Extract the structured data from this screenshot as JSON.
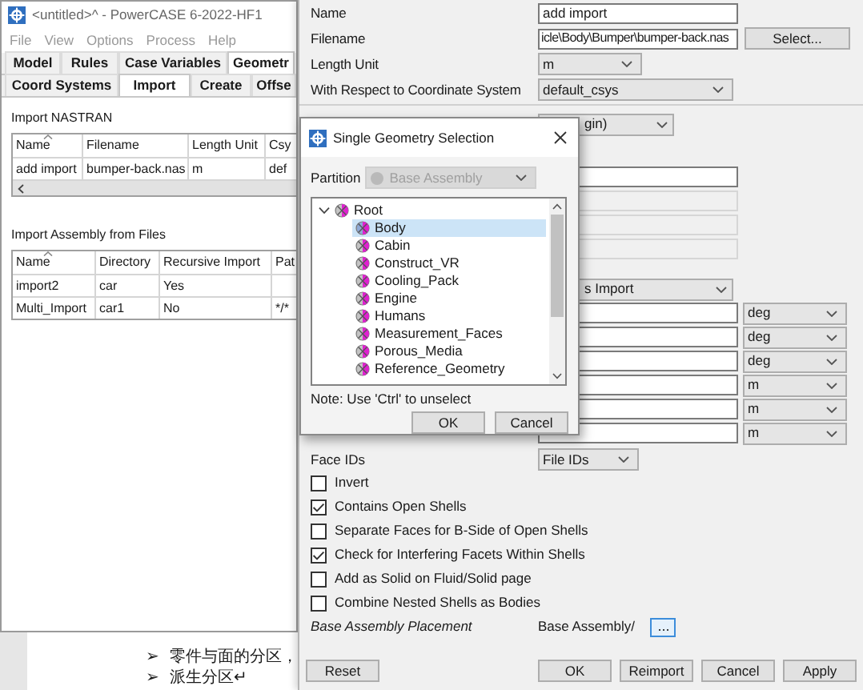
{
  "main_window": {
    "title": "<untitled>^ - PowerCASE 6-2022-HF1",
    "menu": [
      "File",
      "View",
      "Options",
      "Process",
      "Help"
    ],
    "tabs": [
      {
        "label": "Model",
        "selected": false
      },
      {
        "label": "Rules",
        "selected": false
      },
      {
        "label": "Case Variables",
        "selected": false
      },
      {
        "label": "Geometr",
        "selected": true
      }
    ],
    "subtabs": [
      {
        "label": "Coord Systems",
        "selected": false
      },
      {
        "label": "Import",
        "selected": true
      },
      {
        "label": "Create",
        "selected": false
      },
      {
        "label": "Offse",
        "selected": false
      }
    ],
    "nastran": {
      "heading": "Import NASTRAN",
      "columns": [
        "Name",
        "Filename",
        "Length Unit",
        "Csy"
      ],
      "rows": [
        [
          "add import",
          "bumper-back.nas",
          "m",
          "def"
        ]
      ]
    },
    "assembly": {
      "heading": "Import Assembly from Files",
      "columns": [
        "Name",
        "Directory",
        "Recursive Import",
        "Pat"
      ],
      "rows": [
        [
          "import2",
          "car",
          "Yes",
          ""
        ],
        [
          "Multi_Import",
          "car1",
          "No",
          "*/*"
        ]
      ]
    }
  },
  "document": {
    "bullets": [
      {
        "marker": "➢",
        "text": "零件与面的分区，"
      },
      {
        "marker": "➢",
        "text": "派生分区↵"
      }
    ]
  },
  "properties": {
    "fields": [
      {
        "kind": "text",
        "label": "Name",
        "value": "add import"
      },
      {
        "kind": "file",
        "label": "Filename",
        "value": "icle\\Body\\Bumper\\bumper-back.nas",
        "button": "Select..."
      },
      {
        "kind": "dropdown",
        "label": "Length Unit",
        "value": "m"
      },
      {
        "kind": "dropdown",
        "label": "With Respect to Coordinate System",
        "value": "default_csys"
      }
    ],
    "obscured_rows": [
      {
        "kind": "dropdown",
        "value": "gin)"
      },
      {
        "kind": "field",
        "disabled": false
      },
      {
        "kind": "field",
        "disabled": true
      },
      {
        "kind": "field",
        "disabled": true
      },
      {
        "kind": "field",
        "disabled": true
      },
      {
        "kind": "dropdown",
        "value": "s Import"
      },
      {
        "kind": "field_unit",
        "unit": "deg"
      },
      {
        "kind": "field_unit",
        "unit": "deg"
      },
      {
        "kind": "field_unit",
        "unit": "deg"
      },
      {
        "kind": "field_unit",
        "unit": "m"
      },
      {
        "kind": "field_unit",
        "unit": "m"
      },
      {
        "kind": "field_unit",
        "unit": "m"
      }
    ],
    "face_ids": {
      "label": "Face IDs",
      "value": "File IDs"
    },
    "checkboxes": [
      {
        "label": "Invert",
        "checked": false
      },
      {
        "label": "Contains Open Shells",
        "checked": true
      },
      {
        "label": "Separate Faces for B-Side of Open Shells",
        "checked": false
      },
      {
        "label": "Check for Interfering Facets Within Shells",
        "checked": true
      },
      {
        "label": "Add as Solid on Fluid/Solid page",
        "checked": false
      },
      {
        "label": "Combine Nested Shells as Bodies",
        "checked": false
      }
    ],
    "placement": {
      "label": "Base Assembly Placement",
      "value": "Base Assembly/",
      "button": "..."
    },
    "left_buttons": [
      "Reset"
    ],
    "right_buttons": [
      "OK",
      "Reimport",
      "Cancel",
      "Apply"
    ]
  },
  "dialog": {
    "title": "Single Geometry Selection",
    "partition_label": "Partition",
    "partition_value": "Base Assembly",
    "tree": {
      "label": "Root",
      "expanded": true,
      "selected": false,
      "children": [
        {
          "label": "Body",
          "selected": true
        },
        {
          "label": "Cabin",
          "selected": false
        },
        {
          "label": "Construct_VR",
          "selected": false
        },
        {
          "label": "Cooling_Pack",
          "selected": false
        },
        {
          "label": "Engine",
          "selected": false
        },
        {
          "label": "Humans",
          "selected": false
        },
        {
          "label": "Measurement_Faces",
          "selected": false
        },
        {
          "label": "Porous_Media",
          "selected": false
        },
        {
          "label": "Reference_Geometry",
          "selected": false
        }
      ]
    },
    "note": "Note: Use 'Ctrl' to unselect",
    "buttons": [
      "OK",
      "Cancel"
    ]
  }
}
